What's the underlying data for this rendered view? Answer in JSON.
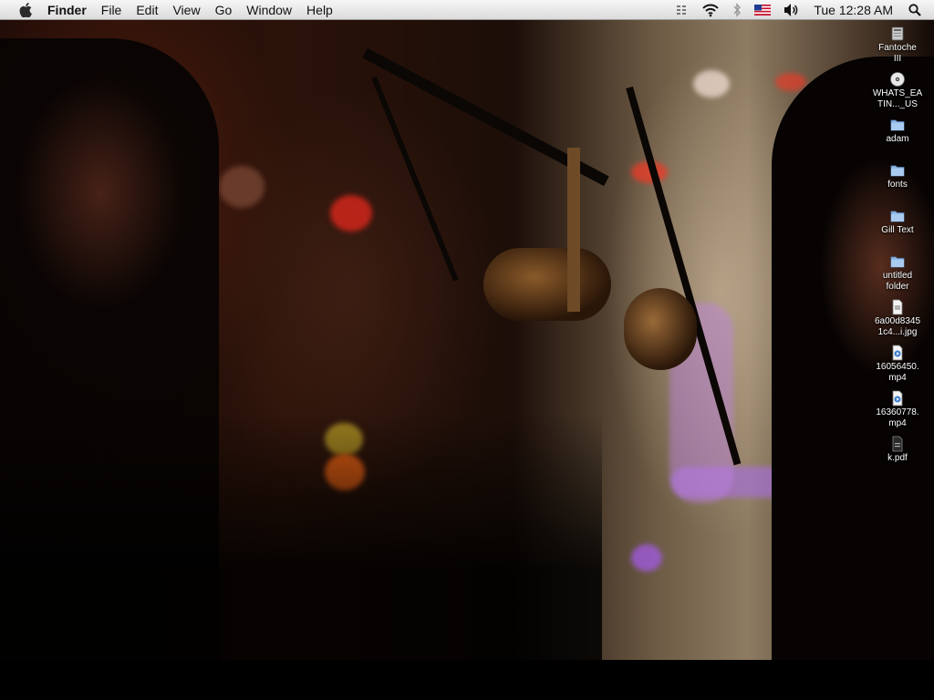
{
  "menubar": {
    "app_name": "Finder",
    "menus": [
      "File",
      "Edit",
      "View",
      "Go",
      "Window",
      "Help"
    ],
    "clock": "Tue 12:28 AM",
    "status_icons": [
      "spotlight-grid-icon",
      "wifi-icon",
      "bluetooth-icon",
      "us-flag-icon",
      "volume-icon"
    ]
  },
  "desktop_icons": [
    {
      "label": "Fantoche\nIII",
      "type": "drive"
    },
    {
      "label": "WHATS_EA\nTIN..._US",
      "type": "disc"
    },
    {
      "label": "adam",
      "type": "folder"
    },
    {
      "label": "fonts",
      "type": "folder"
    },
    {
      "label": "Gill Text",
      "type": "folder"
    },
    {
      "label": "untitled\nfolder",
      "type": "folder"
    },
    {
      "label": "6a00d8345\n1c4...i.jpg",
      "type": "image-file"
    },
    {
      "label": "16056450.\nmp4",
      "type": "video-file"
    },
    {
      "label": "16360778.\nmp4",
      "type": "video-file"
    },
    {
      "label": "k.pdf",
      "type": "pdf-file"
    }
  ],
  "colors": {
    "menubar_top": "#f6f6f6",
    "menubar_bottom": "#dcdcdc",
    "folder_blue": "#8fb8e6"
  }
}
